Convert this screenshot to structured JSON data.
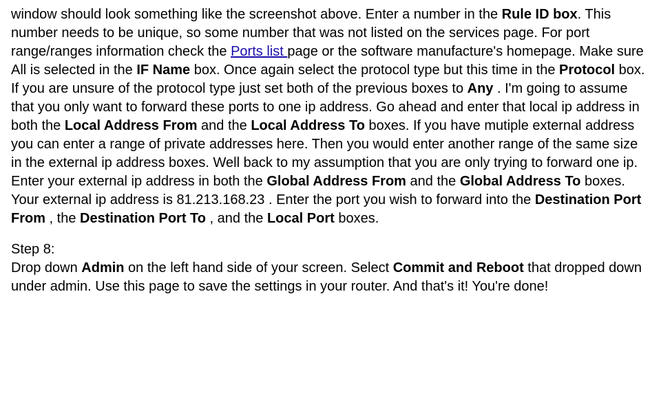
{
  "para1": {
    "s1a": "window should look something like the screenshot above. Enter a number in the ",
    "b1": "Rule ID box",
    "s1b": ". This number needs to be unique, so some number that was not listed on the services page. For port range/ranges information check the ",
    "link": "Ports list ",
    "s2": "page or the software manufacture's homepage. Make sure All is selected in the ",
    "b2": "IF Name",
    "s3": " box. Once again select the protocol type but this time in the ",
    "b3": "Protocol",
    "s4": " box. If you are unsure of the protocol type just set both of the previous boxes to ",
    "b4": "Any",
    "s5": " . I'm going to assume that you only want to forward these ports to one ip address. Go ahead and enter that local ip address in both the ",
    "b5": "Local Address From",
    "s6": " and the ",
    "b6": "Local Address To",
    "s7": " boxes. If you have mutiple external address you can enter a range of private addresses here. Then you would enter another range of the same size in the external ip address boxes. Well back to my assumption that you are only trying to forward one ip. Enter your external ip address in both the ",
    "b7": "Global Address From",
    "s8": " and the ",
    "b8": "Global Address To",
    "s9": " boxes. Your external ip address is 81.213.168.23 . Enter the port you wish to forward into the ",
    "b9": "Destination Port From",
    "s10": " , the ",
    "b10": "Destination Port To",
    "s11": " , and the ",
    "b11": "Local Port",
    "s12": " boxes."
  },
  "para2": {
    "step": "Step 8:",
    "s1": "Drop down ",
    "b1": "Admin",
    "s2": " on the left hand side of your screen. Select ",
    "b2": "Commit and Reboot",
    "s3": " that dropped down under admin. Use this page to save the settings in your router. And that's it! You're done!"
  }
}
